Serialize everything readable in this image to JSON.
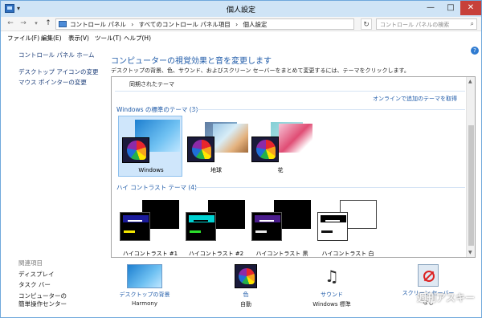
{
  "window": {
    "title": "個人設定"
  },
  "address": {
    "crumbs": [
      "コントロール パネル",
      "›",
      "すべてのコントロール パネル項目",
      "›",
      "個人設定"
    ],
    "search_placeholder": "コントロール パネルの検索"
  },
  "menu": [
    "ファイル(F)",
    "編集(E)",
    "表示(V)",
    "ツール(T)",
    "ヘルプ(H)"
  ],
  "sidebar": {
    "home": "コントロール パネル ホーム",
    "links": [
      "デスクトップ アイコンの変更",
      "マウス ポインターの変更"
    ],
    "related_title": "関連項目",
    "related": [
      "ディスプレイ",
      "タスク バー",
      "コンピューターの",
      "簡単操作センター"
    ]
  },
  "main": {
    "title": "コンピューターの視覚効果と音を変更します",
    "description": "デスクトップの背景、色、サウンド、およびスクリーン セーバーをまとめて変更するには、テーマをクリックします。",
    "saved_label": "同期されたテーマ",
    "online_link": "オンラインで追加のテーマを取得",
    "windows_group": "Windows の標準のテーマ (3)",
    "themes": [
      "Windows",
      "地球",
      "花"
    ],
    "hc_group": "ハイ コントラスト テーマ (4)",
    "hc_themes": [
      "ハイコントラスト #1",
      "ハイコントラスト #2",
      "ハイコントラスト 黒",
      "ハイコントラスト 白"
    ]
  },
  "bottom": [
    {
      "label": "デスクトップの背景",
      "value": "Harmony",
      "icon": "desktop-background-icon"
    },
    {
      "label": "色",
      "value": "自動",
      "icon": "color-icon"
    },
    {
      "label": "サウンド",
      "value": "Windows 標準",
      "icon": "sound-icon"
    },
    {
      "label": "スクリーン セーバー",
      "value": "なし",
      "icon": "screensaver-icon"
    }
  ],
  "watermark": "週刊アスキー",
  "colors": {
    "accent": "#1e5aa8",
    "selected": "#cfe6fb"
  }
}
